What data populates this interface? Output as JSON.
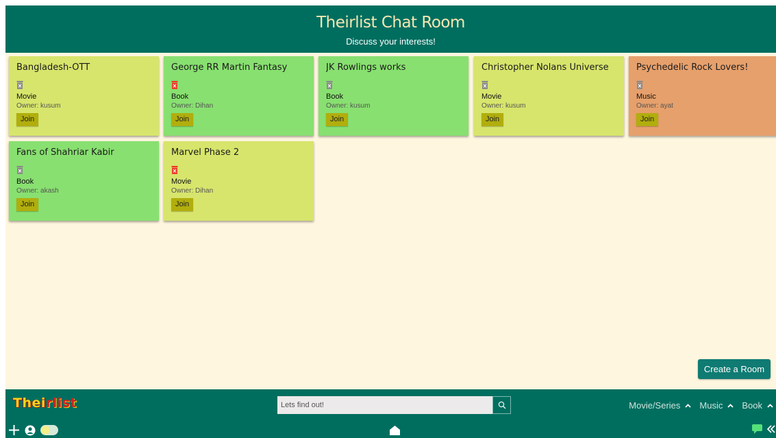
{
  "header": {
    "title": "Theirlist Chat Room",
    "subtitle": "Discuss your interests!"
  },
  "rooms": [
    {
      "name": "Bangladesh-OTT",
      "category": "Movie",
      "owner": "Owner: kusum",
      "join_label": "Join",
      "bg": "#d7e56c",
      "trash_color": "gray"
    },
    {
      "name": "George RR Martin Fantasy",
      "category": "Book",
      "owner": "Owner: Dihan",
      "join_label": "Join",
      "bg": "#88e070",
      "trash_color": "red"
    },
    {
      "name": "JK Rowlings works",
      "category": "Book",
      "owner": "Owner: kusum",
      "join_label": "Join",
      "bg": "#88e070",
      "trash_color": "gray"
    },
    {
      "name": "Christopher Nolans Universe",
      "category": "Movie",
      "owner": "Owner: kusum",
      "join_label": "Join",
      "bg": "#d7e56c",
      "trash_color": "gray"
    },
    {
      "name": "Psychedelic Rock Lovers!",
      "category": "Music",
      "owner": "Owner: ayat",
      "join_label": "Join",
      "bg": "#e6a06c",
      "trash_color": "gray"
    },
    {
      "name": "Fans of Shahriar Kabir",
      "category": "Book",
      "owner": "Owner: akash",
      "join_label": "Join",
      "bg": "#88e070",
      "trash_color": "gray"
    },
    {
      "name": "Marvel Phase 2",
      "category": "Movie",
      "owner": "Owner: Dihan",
      "join_label": "Join",
      "bg": "#d7e56c",
      "trash_color": "red"
    }
  ],
  "create_room_label": "Create a Room",
  "footer": {
    "logo_text_a": "Thei",
    "logo_text_b": "rlist",
    "search_placeholder": "Lets find out!",
    "nav": [
      {
        "label": "Movie/Series"
      },
      {
        "label": "Music"
      },
      {
        "label": "Book"
      }
    ]
  },
  "colors": {
    "header_bg": "#006e5f",
    "page_bg": "#fff6df",
    "card_yellow": "#d7e56c",
    "card_green": "#88e070",
    "card_orange": "#e6a06c",
    "join_bg": "#b1ae0d",
    "create_bg": "#0f7b73"
  },
  "icons": {
    "search": "search-icon",
    "chevron": "chevron-up-icon",
    "plus": "plus-icon",
    "user": "user-icon",
    "toggle": "theme-toggle-icon",
    "home": "home-icon",
    "chat": "chat-icon",
    "collapse": "double-chevron-left-icon",
    "trash": "trash-icon"
  }
}
